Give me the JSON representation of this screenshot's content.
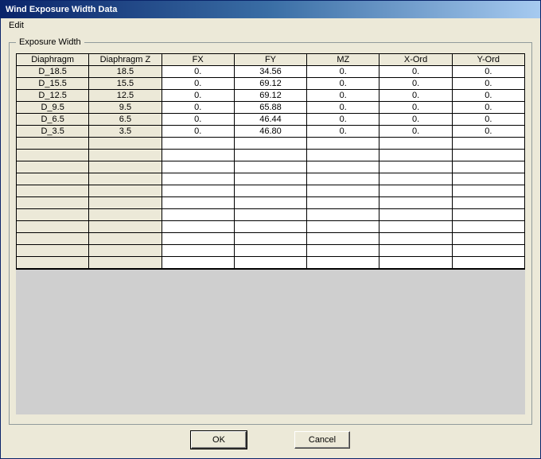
{
  "window": {
    "title": "Wind Exposure Width Data"
  },
  "menubar": {
    "edit": "Edit"
  },
  "group": {
    "legend": "Exposure Width"
  },
  "columns": [
    "Diaphragm",
    "Diaphragm Z",
    "FX",
    "FY",
    "MZ",
    "X-Ord",
    "Y-Ord"
  ],
  "rows": [
    {
      "d": "D_18.5",
      "z": "18.5",
      "fx": "0.",
      "fy": "34.56",
      "mz": "0.",
      "x": "0.",
      "y": "0."
    },
    {
      "d": "D_15.5",
      "z": "15.5",
      "fx": "0.",
      "fy": "69.12",
      "mz": "0.",
      "x": "0.",
      "y": "0."
    },
    {
      "d": "D_12.5",
      "z": "12.5",
      "fx": "0.",
      "fy": "69.12",
      "mz": "0.",
      "x": "0.",
      "y": "0."
    },
    {
      "d": "D_9.5",
      "z": "9.5",
      "fx": "0.",
      "fy": "65.88",
      "mz": "0.",
      "x": "0.",
      "y": "0."
    },
    {
      "d": "D_6.5",
      "z": "6.5",
      "fx": "0.",
      "fy": "46.44",
      "mz": "0.",
      "x": "0.",
      "y": "0."
    },
    {
      "d": "D_3.5",
      "z": "3.5",
      "fx": "0.",
      "fy": "46.80",
      "mz": "0.",
      "x": "0.",
      "y": "0."
    }
  ],
  "empty_rows": 11,
  "buttons": {
    "ok": "OK",
    "cancel": "Cancel"
  }
}
